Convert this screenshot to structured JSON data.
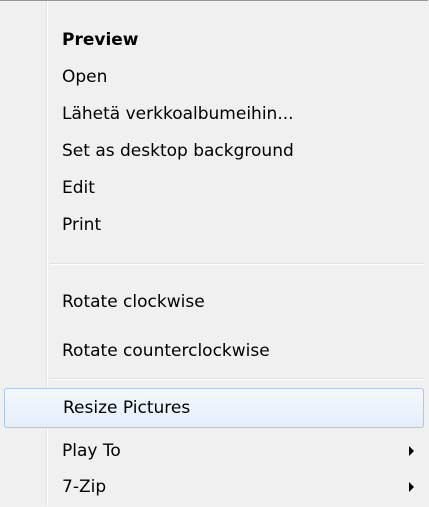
{
  "menu": {
    "items": [
      {
        "label": "Preview"
      },
      {
        "label": "Open"
      },
      {
        "label": "Lähetä verkkoalbumeihin..."
      },
      {
        "label": "Set as desktop background"
      },
      {
        "label": "Edit"
      },
      {
        "label": "Print"
      },
      {
        "label": "Rotate clockwise"
      },
      {
        "label": "Rotate counterclockwise"
      },
      {
        "label": "Resize Pictures"
      },
      {
        "label": "Play To"
      },
      {
        "label": "7-Zip"
      }
    ]
  },
  "colors": {
    "background": "#f0f0f0",
    "hover_border": "#a8c8ef",
    "hover_fill": "#e4eefb",
    "text": "#000000"
  },
  "icons": {
    "submenu": "submenu-arrow-icon"
  }
}
